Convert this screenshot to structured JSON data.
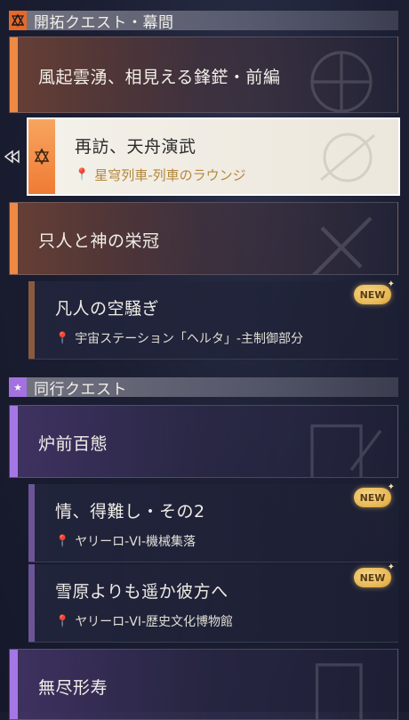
{
  "sections": {
    "trailblaze": {
      "title": "開拓クエスト・幕間",
      "icon": "trailblaze-mission-icon"
    },
    "companion": {
      "title": "同行クエスト",
      "icon": "companion-star-icon"
    }
  },
  "trailblaze_quests": [
    {
      "title": "風起雲湧、相見える鋒鋩・前編"
    },
    {
      "title": "再訪、天舟演武",
      "location": "星穹列車-列車のラウンジ",
      "selected": true
    },
    {
      "title": "只人と神の栄冠"
    },
    {
      "title": "凡人の空騒ぎ",
      "location": "宇宙ステーション「ヘルタ」-主制御部分",
      "badge": "NEW"
    }
  ],
  "companion_quests": [
    {
      "title": "炉前百態"
    },
    {
      "title": "情、得難し・その2",
      "location": "ヤリーロ-VI-機械集落",
      "badge": "NEW"
    },
    {
      "title": "雪原よりも遥か彼方へ",
      "location": "ヤリーロ-VI-歴史文化博物館",
      "badge": "NEW"
    },
    {
      "title": "無尽形寿"
    }
  ],
  "icons": {
    "location": "map-pin-icon",
    "selector": "selection-pointer-icon",
    "badge_sparkle": "sparkle-icon"
  },
  "colors": {
    "trailblaze_accent": "#ee8a45",
    "companion_accent": "#a577e6",
    "badge_gold": "#e6b451",
    "selected_bg": "#f4f1ea"
  }
}
